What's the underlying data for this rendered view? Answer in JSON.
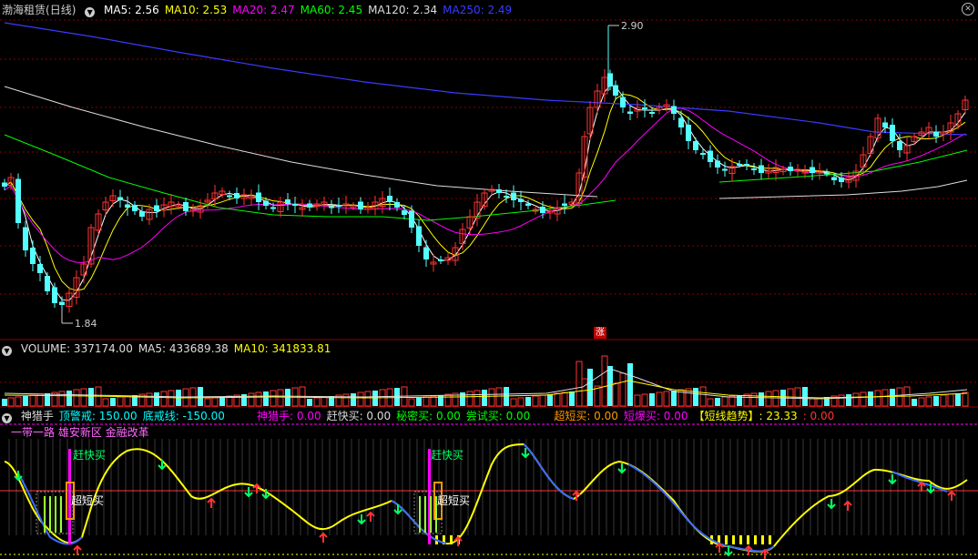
{
  "price_panel": {
    "stock_name": "渤海租赁",
    "period": "(日线)",
    "ma_items": [
      {
        "label": "MA5: 2.56",
        "color": "#ffffff"
      },
      {
        "label": "MA10: 2.53",
        "color": "#ffff00"
      },
      {
        "label": "MA20: 2.47",
        "color": "#ff00ff"
      },
      {
        "label": "MA60: 2.45",
        "color": "#00ff00"
      },
      {
        "label": "MA120: 2.34",
        "color": "#dddddd"
      },
      {
        "label": "MA250: 2.49",
        "color": "#3a3aff"
      }
    ],
    "high_label": "2.90",
    "low_label": "1.84",
    "limit_badge": "涨"
  },
  "volume_panel": {
    "items": [
      {
        "label": "VOLUME: 337174.00",
        "color": "#dddddd"
      },
      {
        "label": "MA5: 433689.38",
        "color": "#dddddd"
      },
      {
        "label": "MA10: 341833.81",
        "color": "#ffff00"
      }
    ]
  },
  "indicator_panel": {
    "items": [
      {
        "label": "神猎手",
        "color": "#dddddd"
      },
      {
        "label": "顶警戒: 150.00",
        "color": "#00ffff"
      },
      {
        "label": "底戒线: -150.00",
        "color": "#00ffff"
      },
      {
        "label": "神猎手: 0.00",
        "color": "#ff00ff"
      },
      {
        "label": "赶快买: 0.00",
        "color": "#dddddd"
      },
      {
        "label": "秘密买: 0.00",
        "color": "#00ff00"
      },
      {
        "label": "尝试买: 0.00",
        "color": "#00ff00"
      },
      {
        "label": "超短买: 0.00",
        "color": "#ff9900"
      },
      {
        "label": "短爆买: 0.00",
        "color": "#ff00ff"
      },
      {
        "label": "【短线趋势】: 23.33",
        "color": "#ffff00"
      },
      {
        "label": ": 0.00",
        "color": "#ff3333"
      }
    ],
    "slogan": "一带一路 雄安新区 金融改革",
    "signal_quick_buy": "赶快买",
    "signal_ultra_short": "超短买"
  },
  "colors": {
    "up": "#ff3333",
    "down": "#54ffff",
    "bg": "#000000",
    "grid": "#8b0000"
  }
}
